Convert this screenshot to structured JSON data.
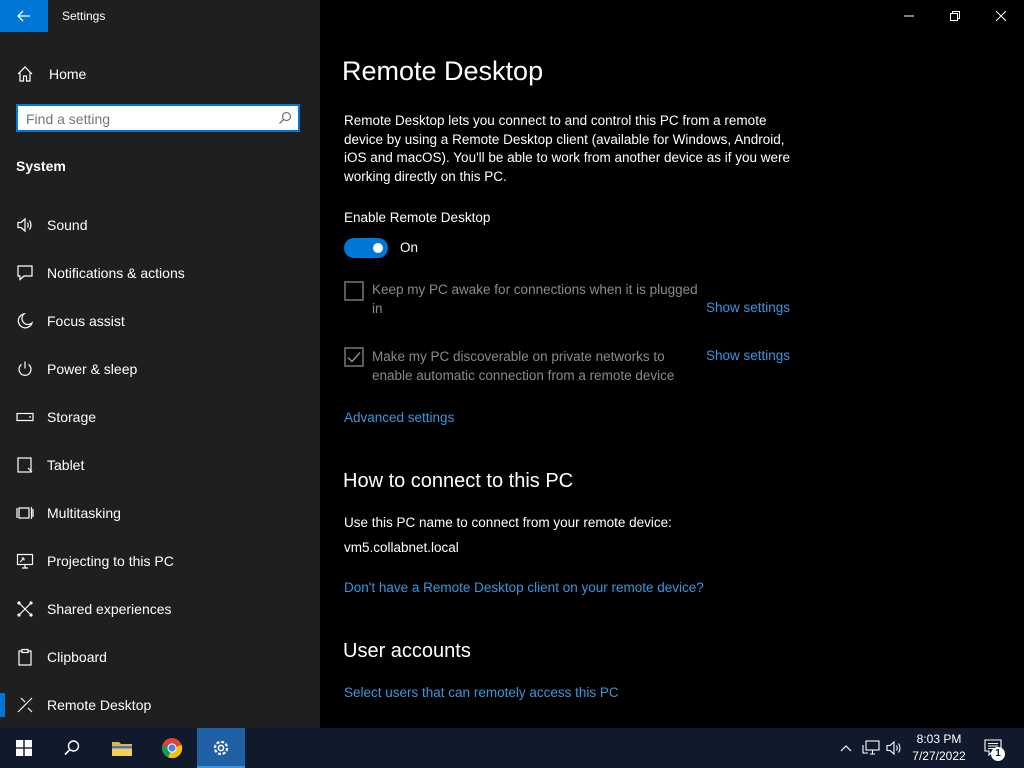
{
  "window": {
    "title": "Settings"
  },
  "sidebar": {
    "home_label": "Home",
    "search_placeholder": "Find a setting",
    "section": "System",
    "items": [
      {
        "label": "Sound",
        "icon": "speaker-icon"
      },
      {
        "label": "Notifications & actions",
        "icon": "notifications-icon"
      },
      {
        "label": "Focus assist",
        "icon": "moon-icon"
      },
      {
        "label": "Power & sleep",
        "icon": "power-icon"
      },
      {
        "label": "Storage",
        "icon": "storage-icon"
      },
      {
        "label": "Tablet",
        "icon": "tablet-icon"
      },
      {
        "label": "Multitasking",
        "icon": "multitasking-icon"
      },
      {
        "label": "Projecting to this PC",
        "icon": "projecting-icon"
      },
      {
        "label": "Shared experiences",
        "icon": "shared-experiences-icon"
      },
      {
        "label": "Clipboard",
        "icon": "clipboard-icon"
      },
      {
        "label": "Remote Desktop",
        "icon": "remote-desktop-icon",
        "active": true
      }
    ]
  },
  "main": {
    "title": "Remote Desktop",
    "description": "Remote Desktop lets you connect to and control this PC from a remote device by using a Remote Desktop client (available for Windows, Android, iOS and macOS). You'll be able to work from another device as if you were working directly on this PC.",
    "enable_label": "Enable Remote Desktop",
    "toggle_state": "On",
    "options": [
      {
        "label": "Keep my PC awake for connections when it is plugged in",
        "checked": false,
        "link": "Show settings"
      },
      {
        "label": "Make my PC discoverable on private networks to enable automatic connection from a remote device",
        "checked": true,
        "link": "Show settings"
      }
    ],
    "advanced_link": "Advanced settings",
    "connect": {
      "heading": "How to connect to this PC",
      "instruction": "Use this PC name to connect from your remote device:",
      "pc_name": "vm5.collabnet.local",
      "client_link": "Don't have a Remote Desktop client on your remote device?"
    },
    "accounts": {
      "heading": "User accounts",
      "link": "Select users that can remotely access this PC"
    }
  },
  "taskbar": {
    "time": "8:03 PM",
    "date": "7/27/2022",
    "notification_count": "1"
  },
  "colors": {
    "accent": "#0078d7",
    "link": "#3a96dd",
    "sidebar_bg": "#1f1f1f",
    "taskbar_bg": "#101a2c"
  }
}
